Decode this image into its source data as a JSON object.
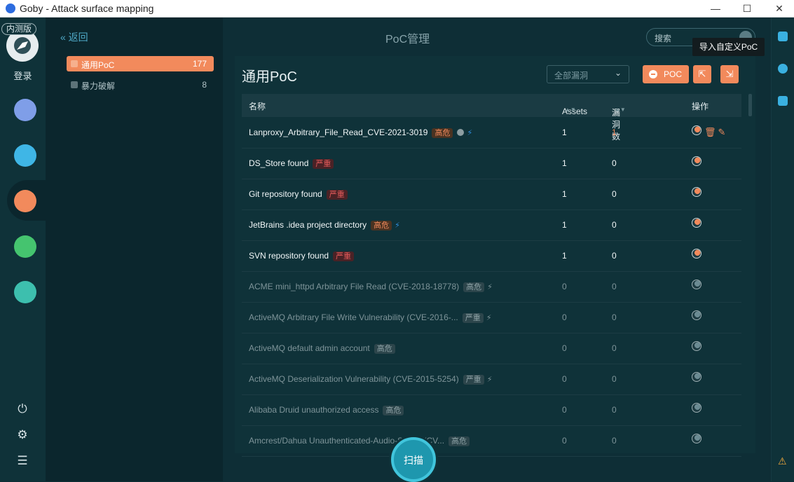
{
  "window": {
    "title": "Goby - Attack surface mapping",
    "controls": [
      "—",
      "☐",
      "✕"
    ]
  },
  "leftnav": {
    "beta": "内测版",
    "login": "登录",
    "bottom_icons": [
      "⏻",
      "⚙",
      "☰"
    ]
  },
  "header": {
    "back": "« 返回",
    "title": "PoC管理",
    "search_placeholder": "搜索",
    "tooltip": "导入自定义PoC"
  },
  "categories": [
    {
      "label": "通用PoC",
      "count": "177",
      "active": true
    },
    {
      "label": "暴力破解",
      "count": "8",
      "active": false
    }
  ],
  "panel": {
    "title": "通用PoC",
    "filter": "全部漏洞",
    "poc_button": "POC",
    "columns": {
      "name": "名称",
      "assets": "Assets",
      "vulns": "漏洞数",
      "actions": "操作"
    }
  },
  "rows": [
    {
      "name": "Lanproxy_Arbitrary_File_Read_CVE-2021-3019",
      "tag": "高危",
      "level": "high",
      "lock": true,
      "bolt": true,
      "assets": "1",
      "vulns": "1",
      "active": true,
      "edit": true
    },
    {
      "name": "DS_Store found",
      "tag": "严重",
      "level": "crit",
      "lock": false,
      "bolt": false,
      "assets": "1",
      "vulns": "0",
      "active": true,
      "edit": false
    },
    {
      "name": "Git repository found",
      "tag": "严重",
      "level": "crit",
      "lock": false,
      "bolt": false,
      "assets": "1",
      "vulns": "0",
      "active": true,
      "edit": false
    },
    {
      "name": "JetBrains .idea project directory",
      "tag": "高危",
      "level": "high",
      "lock": false,
      "bolt": true,
      "assets": "1",
      "vulns": "0",
      "active": true,
      "edit": false
    },
    {
      "name": "SVN repository found",
      "tag": "严重",
      "level": "crit",
      "lock": false,
      "bolt": false,
      "assets": "1",
      "vulns": "0",
      "active": true,
      "edit": false
    },
    {
      "name": "ACME mini_httpd Arbitrary File Read (CVE-2018-18778)",
      "tag": "高危",
      "level": "off",
      "lock": false,
      "bolt": true,
      "assets": "0",
      "vulns": "0",
      "active": false,
      "edit": false
    },
    {
      "name": "ActiveMQ Arbitrary File Write Vulnerability (CVE-2016-...",
      "tag": "严重",
      "level": "off",
      "lock": false,
      "bolt": true,
      "assets": "0",
      "vulns": "0",
      "active": false,
      "edit": false
    },
    {
      "name": "ActiveMQ default admin account",
      "tag": "高危",
      "level": "off",
      "lock": false,
      "bolt": false,
      "assets": "0",
      "vulns": "0",
      "active": false,
      "edit": false
    },
    {
      "name": "ActiveMQ Deserialization Vulnerability (CVE-2015-5254)",
      "tag": "严重",
      "level": "off",
      "lock": false,
      "bolt": true,
      "assets": "0",
      "vulns": "0",
      "active": false,
      "edit": false
    },
    {
      "name": "Alibaba Druid unauthorized access",
      "tag": "高危",
      "level": "off",
      "lock": false,
      "bolt": false,
      "assets": "0",
      "vulns": "0",
      "active": false,
      "edit": false
    },
    {
      "name": "Amcrest/Dahua Unauthenticated-Audio-S...ing (CV...",
      "tag": "高危",
      "level": "off",
      "lock": false,
      "bolt": false,
      "assets": "0",
      "vulns": "0",
      "active": false,
      "edit": false
    }
  ],
  "scan_button": "扫描",
  "colors": {
    "accent": "#f28a5c",
    "bg": "#0f3239",
    "blue": "#2f8ee0"
  }
}
